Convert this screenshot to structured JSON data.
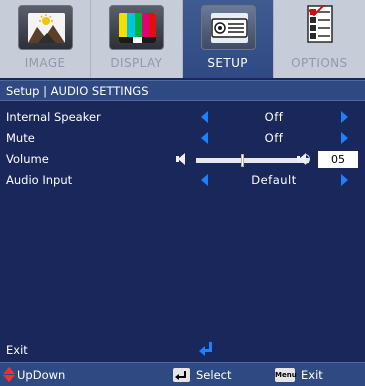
{
  "tabs": [
    {
      "label": "IMAGE",
      "icon": "image-icon",
      "active": false
    },
    {
      "label": "DISPLAY",
      "icon": "display-icon",
      "active": false
    },
    {
      "label": "SETUP",
      "icon": "projector-icon",
      "active": true
    },
    {
      "label": "OPTIONS",
      "icon": "options-checklist-icon",
      "active": false
    }
  ],
  "title": "Setup | AUDIO SETTINGS",
  "rows": [
    {
      "name": "Internal Speaker",
      "value": "Off"
    },
    {
      "name": "Mute",
      "value": "Off"
    },
    {
      "name": "Volume",
      "value": "05",
      "level": 0.42
    },
    {
      "name": "Audio Input",
      "value": "Default"
    }
  ],
  "exit_label": "Exit",
  "footer": {
    "updown_label": "UpDown",
    "select_label": "Select",
    "menu_key_label": "Menu",
    "exit_label": "Exit"
  },
  "colors": {
    "background": "#19275a",
    "tab_bar": "#c7cdd8",
    "active_tab": "#2f4a82",
    "arrow_blue": "#1d80ff",
    "updown_red": "#ff2b2b"
  }
}
